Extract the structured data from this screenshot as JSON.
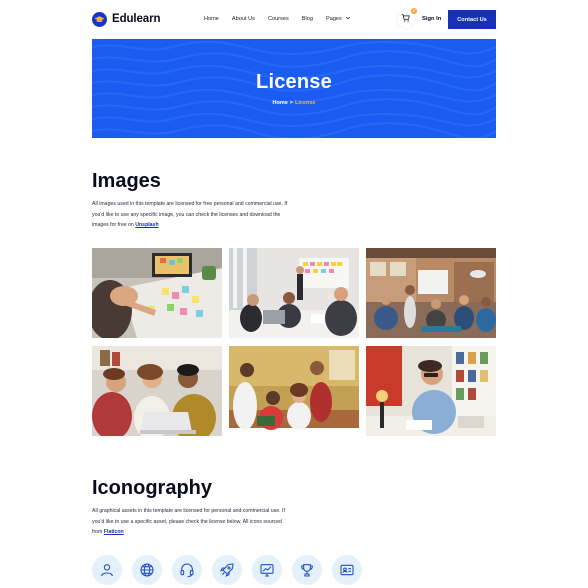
{
  "brand": {
    "name": "Edulearn"
  },
  "nav": {
    "items": [
      "Home",
      "About Us",
      "Courses",
      "Blog",
      "Pages"
    ]
  },
  "header": {
    "cart_count": "0",
    "sign_in": "Sign In",
    "contact": "Contact Us"
  },
  "hero": {
    "title": "License",
    "breadcrumb_home": "Home",
    "breadcrumb_sep": ">",
    "breadcrumb_current": "License"
  },
  "images_section": {
    "title": "Images",
    "text": "All images used in this template are licensed for free personal and commercial use. If you'd like to use any specific image, you can check the licenses and download the images for free on ",
    "link": "Unsplash"
  },
  "iconography_section": {
    "title": "Iconography",
    "text": "All graphical assets in this template are licensed for personal and commercial use. If you'd like to use a specific asset, please check the license below. All icons sourced from ",
    "link": "Flaticon"
  },
  "icons": [
    "user-icon",
    "globe-icon",
    "headset-icon",
    "rocket-icon",
    "chart-monitor-icon",
    "trophy-icon",
    "id-card-icon"
  ],
  "colors": {
    "brand_blue": "#1630b8",
    "hero_blue": "#1a5bf0",
    "accent_orange": "#f5b24a",
    "icon_bg": "#e4f1fb"
  }
}
